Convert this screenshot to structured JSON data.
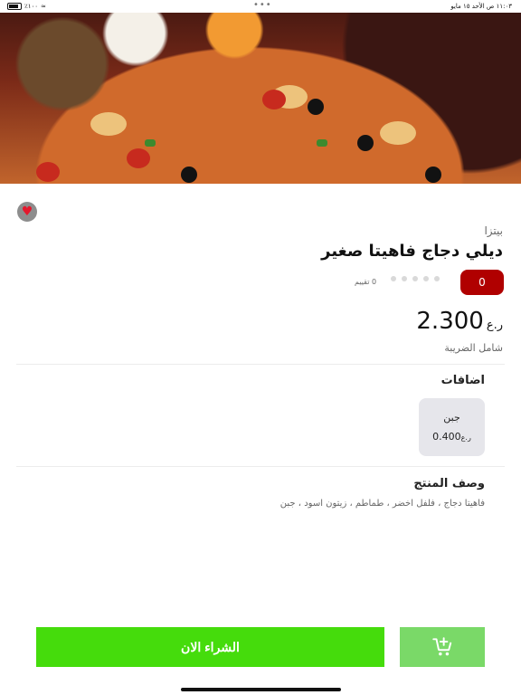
{
  "status_bar": {
    "time": "١١:٠٣ ص  الأحد ١٥ مايو",
    "battery": "٪١٠٠"
  },
  "product": {
    "category": "بيتزا",
    "title": "ديلي دجاج فاهيتا صغير",
    "rating_badge": "0",
    "rating_stars": 0,
    "reviews_text": "0 تقييم",
    "price": "2.300",
    "currency": "ر.ع",
    "tax_note": "شامل الضريبة"
  },
  "addons": {
    "title": "اضافات",
    "items": [
      {
        "name": "جبن",
        "price": "0.400",
        "currency": "ر.ع"
      }
    ]
  },
  "description": {
    "title": "وصف المنتج",
    "text": "فاهيتا دجاج ، فلفل اخضر ، طماطم ، زيتون اسود ، جبن"
  },
  "actions": {
    "buy_now": "الشراء الان"
  },
  "colors": {
    "buy_button": "#45dc0c",
    "cart_button": "#7ad968",
    "rating_badge": "#b00000",
    "favorite": "#e3182d"
  }
}
